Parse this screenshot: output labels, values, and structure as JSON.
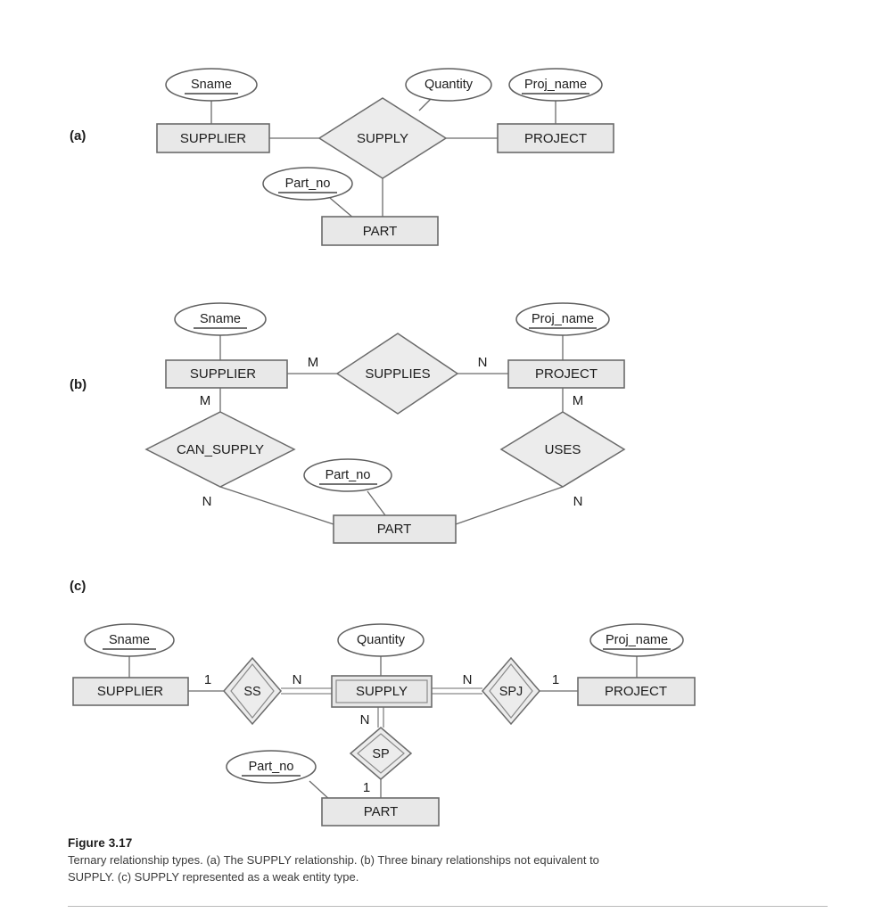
{
  "figure": {
    "number_label": "Figure 3.17",
    "caption": "Ternary relationship types. (a) The SUPPLY relationship. (b) Three binary relationships not equivalent to SUPPLY. (c) SUPPLY represented as a weak entity type."
  },
  "colors": {
    "entity_fill": "#e8e8e8",
    "relationship_fill": "#ececec",
    "attribute_fill": "#ffffff",
    "line": "#6b6b6b",
    "text": "#1c1c1c"
  },
  "parts": {
    "a": {
      "label": "(a)",
      "entities": [
        {
          "name": "SUPPLIER"
        },
        {
          "name": "PROJECT"
        },
        {
          "name": "PART"
        }
      ],
      "relationships": [
        {
          "name": "SUPPLY",
          "kind": "ternary"
        }
      ],
      "attributes": [
        {
          "name": "Sname",
          "key": true,
          "owner": "SUPPLIER"
        },
        {
          "name": "Quantity",
          "key": false,
          "owner": "SUPPLY"
        },
        {
          "name": "Proj_name",
          "key": true,
          "owner": "PROJECT"
        },
        {
          "name": "Part_no",
          "key": true,
          "owner": "PART"
        }
      ],
      "cardinalities": []
    },
    "b": {
      "label": "(b)",
      "entities": [
        {
          "name": "SUPPLIER"
        },
        {
          "name": "PROJECT"
        },
        {
          "name": "PART"
        }
      ],
      "relationships": [
        {
          "name": "SUPPLIES",
          "kind": "binary"
        },
        {
          "name": "CAN_SUPPLY",
          "kind": "binary"
        },
        {
          "name": "USES",
          "kind": "binary"
        }
      ],
      "attributes": [
        {
          "name": "Sname",
          "key": true,
          "owner": "SUPPLIER"
        },
        {
          "name": "Proj_name",
          "key": true,
          "owner": "PROJECT"
        },
        {
          "name": "Part_no",
          "key": true,
          "owner": "PART"
        }
      ],
      "cardinalities": [
        {
          "edge": "SUPPLIER-SUPPLIES",
          "value": "M"
        },
        {
          "edge": "SUPPLIES-PROJECT",
          "value": "N"
        },
        {
          "edge": "SUPPLIER-CAN_SUPPLY",
          "value": "M"
        },
        {
          "edge": "CAN_SUPPLY-PART",
          "value": "N"
        },
        {
          "edge": "PROJECT-USES",
          "value": "M"
        },
        {
          "edge": "USES-PART",
          "value": "N"
        }
      ]
    },
    "c": {
      "label": "(c)",
      "entities": [
        {
          "name": "SUPPLIER",
          "weak": false
        },
        {
          "name": "SUPPLY",
          "weak": true
        },
        {
          "name": "PROJECT",
          "weak": false
        },
        {
          "name": "PART",
          "weak": false
        }
      ],
      "relationships": [
        {
          "name": "SS",
          "kind": "identifying"
        },
        {
          "name": "SPJ",
          "kind": "identifying"
        },
        {
          "name": "SP",
          "kind": "identifying"
        }
      ],
      "attributes": [
        {
          "name": "Sname",
          "key": true,
          "owner": "SUPPLIER"
        },
        {
          "name": "Quantity",
          "key": false,
          "owner": "SUPPLY"
        },
        {
          "name": "Proj_name",
          "key": true,
          "owner": "PROJECT"
        },
        {
          "name": "Part_no",
          "key": true,
          "owner": "PART"
        }
      ],
      "cardinalities": [
        {
          "edge": "SUPPLIER-SS",
          "value": "1"
        },
        {
          "edge": "SS-SUPPLY",
          "value": "N"
        },
        {
          "edge": "SUPPLY-SPJ",
          "value": "N"
        },
        {
          "edge": "SPJ-PROJECT",
          "value": "1"
        },
        {
          "edge": "SUPPLY-SP",
          "value": "N"
        },
        {
          "edge": "SP-PART",
          "value": "1"
        }
      ]
    }
  }
}
